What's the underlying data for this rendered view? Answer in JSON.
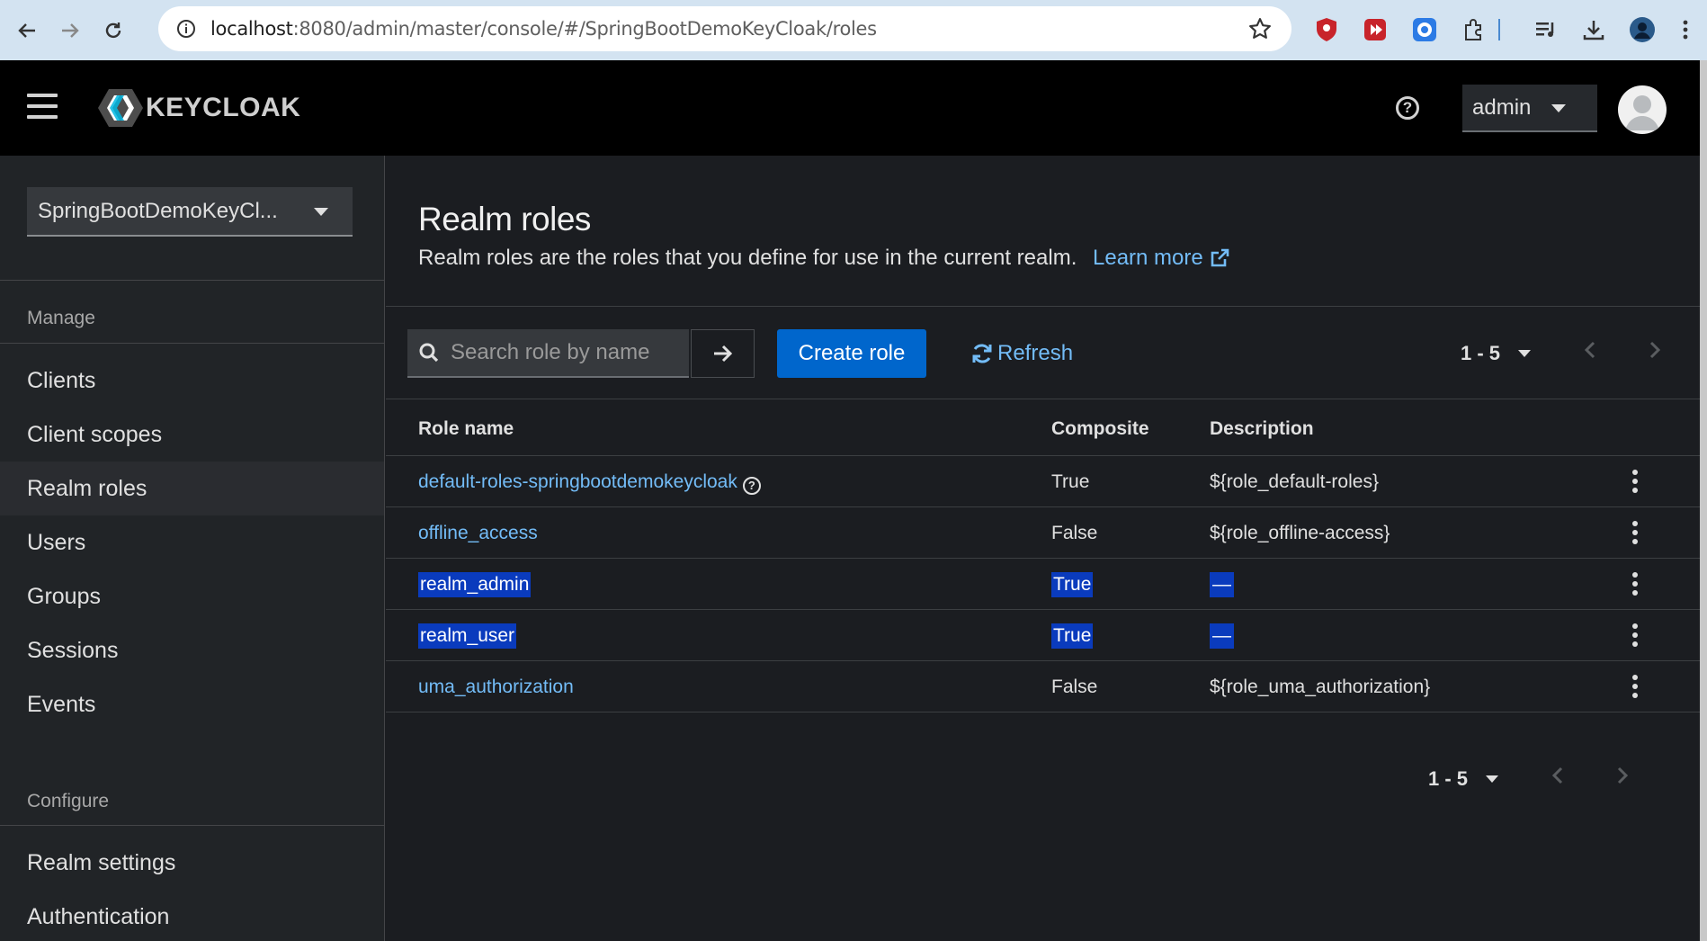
{
  "browser": {
    "url_host": "localhost",
    "url_path": ":8080/admin/master/console/#/SpringBootDemoKeyCloak/roles"
  },
  "header": {
    "logo_text": "KEYCLOAK",
    "user": "admin"
  },
  "sidebar": {
    "realm": "SpringBootDemoKeyCl...",
    "manage_label": "Manage",
    "manage_items": [
      {
        "label": "Clients"
      },
      {
        "label": "Client scopes"
      },
      {
        "label": "Realm roles",
        "active": true
      },
      {
        "label": "Users"
      },
      {
        "label": "Groups"
      },
      {
        "label": "Sessions"
      },
      {
        "label": "Events"
      }
    ],
    "configure_label": "Configure",
    "configure_items": [
      {
        "label": "Realm settings"
      },
      {
        "label": "Authentication"
      }
    ]
  },
  "page": {
    "title": "Realm roles",
    "description": "Realm roles are the roles that you define for use in the current realm.",
    "learn_more": "Learn more"
  },
  "toolbar": {
    "search_placeholder": "Search role by name",
    "create_label": "Create role",
    "refresh_label": "Refresh",
    "pagination_range": "1 - 5"
  },
  "table": {
    "headers": [
      "Role name",
      "Composite",
      "Description"
    ],
    "rows": [
      {
        "name": "default-roles-springbootdemokeycloak",
        "composite": "True",
        "description": "${role_default-roles}",
        "help": true,
        "selected": false
      },
      {
        "name": "offline_access",
        "composite": "False",
        "description": "${role_offline-access}",
        "selected": false
      },
      {
        "name": "realm_admin",
        "composite": "True",
        "description": "—",
        "selected": true
      },
      {
        "name": "realm_user",
        "composite": "True",
        "description": "—",
        "selected": true
      },
      {
        "name": "uma_authorization",
        "composite": "False",
        "description": "${role_uma_authorization}",
        "selected": false
      }
    ]
  },
  "footer_pagination": {
    "range": "1 - 5"
  },
  "colors": {
    "accent": "#0066cc",
    "link": "#73bcf7",
    "selection": "#0a3bbd"
  }
}
